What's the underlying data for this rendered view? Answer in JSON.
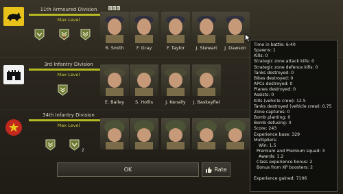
{
  "divisions": [
    {
      "name": "11th Armoured Division",
      "level": "Max Level",
      "emblem_color": "#e8c21b",
      "soldiers": [
        "R. Smith",
        "F. Gray",
        "F. Taylor",
        "J. Stewart",
        "J. Dawson"
      ]
    },
    {
      "name": "3rd Infantry Division",
      "level": "Max Level",
      "emblem_color": "#f2f2f2",
      "soldiers": [
        "E. Bailey",
        "S. Hollis",
        "J. Kenally",
        "J. Baskeyfiel"
      ]
    },
    {
      "name": "34th Infantry Division",
      "level": "Max Level",
      "emblem_color": "#c2281d",
      "badge_count": "2",
      "soldiers": [
        "",
        "",
        "",
        "",
        ""
      ]
    }
  ],
  "buttons": {
    "ok": "OK",
    "rate": "Rate"
  },
  "tooltip": {
    "time_in_battle": "Time in battle: 6:40",
    "spawns": "Spawns: 1",
    "kills": "Kills: 0",
    "strategic_attack": "Strategic zone attack kills: 0",
    "strategic_defence": "Strategic zone defence kills: 0",
    "tanks_destroyed": "Tanks destroyed: 0",
    "bikes_destroyed": "Bikes destroyed: 0",
    "apcs_destroyed": "APCs destroyed: 0",
    "planes_destroyed": "Planes destroyed: 0",
    "assists": "Assists: 0",
    "kills_vehicle_crew": "Kills (vehicle crew): 12.5",
    "tanks_destroyed_vehicle_crew": "Tanks destroyed (vehicle crew): 0.75",
    "zone_captures": "Zone captures: 0",
    "bomb_planting": "Bomb planting: 0",
    "bomb_defusing": "Bomb defusing: 0",
    "score": "Score: 243",
    "experience_base": "Experience base: 329",
    "multipliers": "Multipliers:",
    "win": "Win: 1.5",
    "premium_squad": "Premium and Premium squad: 3",
    "awards": "Awards: 1.2",
    "class_bonus": "Class experience bonus: 2",
    "xp_boosters": "Bonus from XP boosters: 2",
    "experience_gained": "Experience gained: 7106"
  },
  "icons": {
    "emblem_1": "rhino-emblem-icon",
    "emblem_2": "castle-emblem-icon",
    "emblem_3": "red-star-emblem-icon",
    "badge": "chevron-badge-icon",
    "rate": "thumbs-up-icon"
  }
}
